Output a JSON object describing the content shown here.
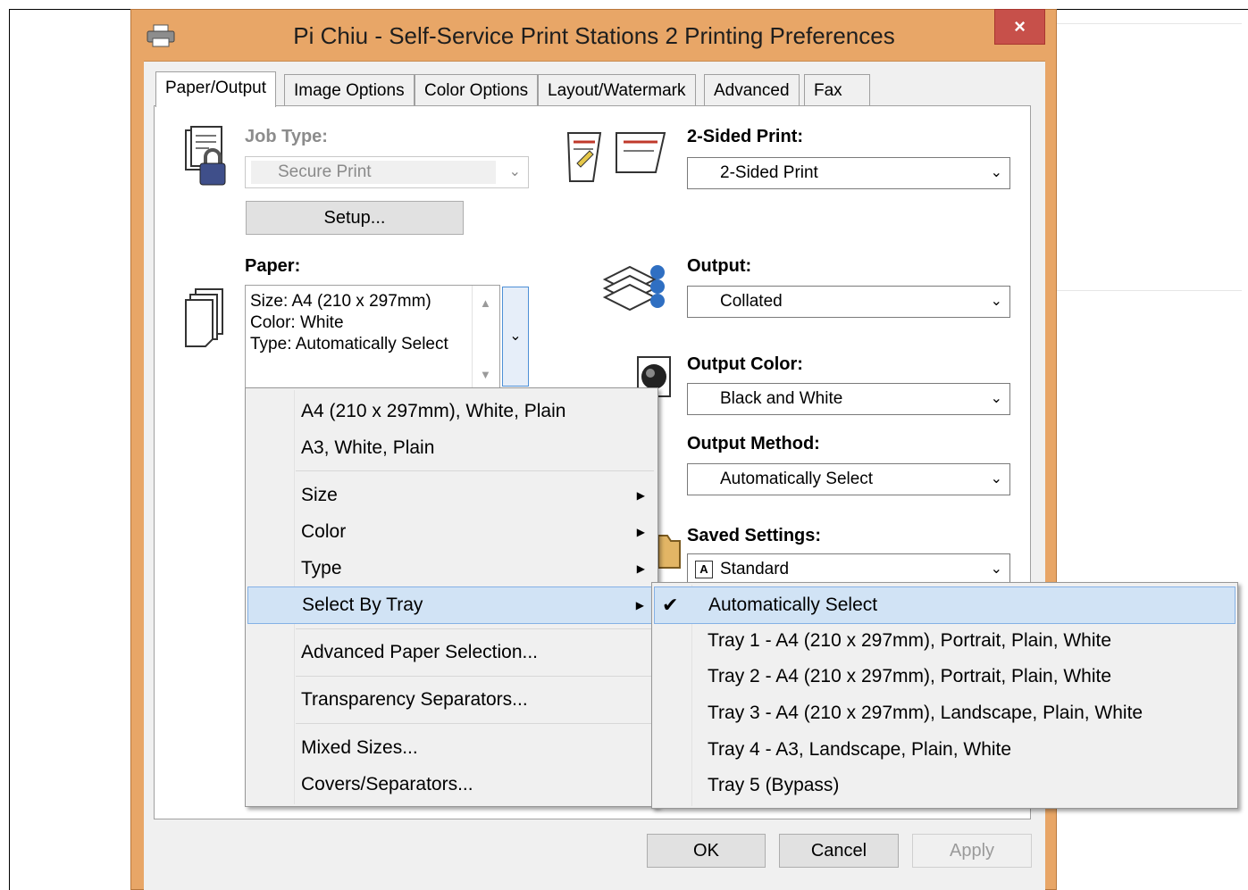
{
  "window": {
    "title": "Pi Chiu - Self-Service Print Stations 2 Printing Preferences",
    "close_glyph": "×"
  },
  "tabs": [
    {
      "label": "Paper/Output"
    },
    {
      "label": "Image Options"
    },
    {
      "label": "Color Options"
    },
    {
      "label": "Layout/Watermark"
    },
    {
      "label": "Advanced"
    },
    {
      "label": "Fax"
    }
  ],
  "job_type": {
    "label": "Job Type:",
    "value": "Secure Print",
    "setup_label": "Setup..."
  },
  "paper": {
    "label": "Paper:",
    "lines": [
      "Size: A4 (210 x 297mm)",
      "Color: White",
      "Type: Automatically Select"
    ]
  },
  "two_sided": {
    "label": "2-Sided Print:",
    "value": "2-Sided Print"
  },
  "output": {
    "label": "Output:",
    "value": "Collated"
  },
  "output_color": {
    "label": "Output Color:",
    "value": "Black and White"
  },
  "output_method": {
    "label": "Output Method:",
    "value": "Automatically Select"
  },
  "saved_settings": {
    "label": "Saved Settings:",
    "value": "Standard",
    "icon_letter": "A"
  },
  "paper_menu": {
    "items": [
      {
        "label": "A4 (210 x 297mm), White, Plain"
      },
      {
        "label": "A3, White, Plain"
      },
      {
        "label": "Size",
        "submenu": true
      },
      {
        "label": "Color",
        "submenu": true
      },
      {
        "label": "Type",
        "submenu": true
      },
      {
        "label": "Select By Tray",
        "submenu": true,
        "highlighted": true
      },
      {
        "label": "Advanced Paper Selection..."
      },
      {
        "label": "Transparency Separators..."
      },
      {
        "label": "Mixed Sizes..."
      },
      {
        "label": "Covers/Separators..."
      }
    ]
  },
  "tray_menu": {
    "items": [
      {
        "label": "Automatically Select",
        "checked": true,
        "highlighted": true
      },
      {
        "label": "Tray 1 - A4 (210 x 297mm), Portrait, Plain, White"
      },
      {
        "label": "Tray 2 - A4 (210 x 297mm), Portrait, Plain, White"
      },
      {
        "label": "Tray 3 - A4 (210 x 297mm), Landscape, Plain, White"
      },
      {
        "label": "Tray 4 - A3, Landscape, Plain, White"
      },
      {
        "label": "Tray 5 (Bypass)"
      }
    ]
  },
  "buttons": {
    "ok": "OK",
    "cancel": "Cancel",
    "apply": "Apply"
  },
  "colors": {
    "window_frame": "#e8a667",
    "close_button": "#c7504a",
    "menu_highlight": "#d1e3f5"
  }
}
